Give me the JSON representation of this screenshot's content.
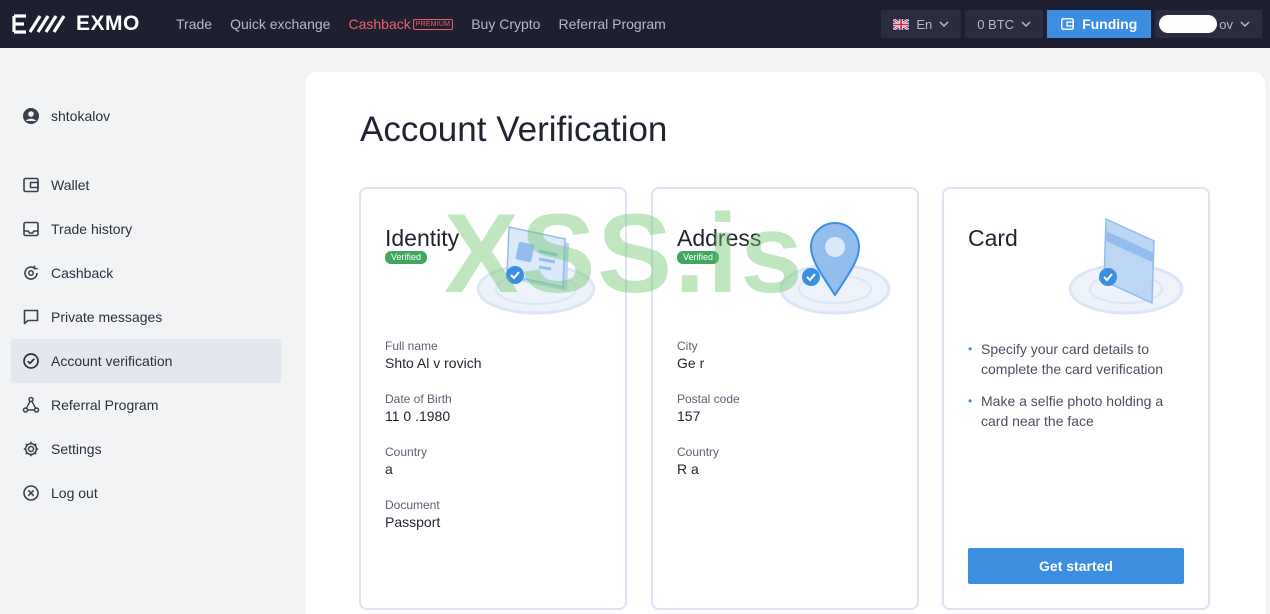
{
  "header": {
    "logo_text": "EXMO",
    "nav": [
      {
        "label": "Trade"
      },
      {
        "label": "Quick exchange"
      },
      {
        "label": "Cashback",
        "badge": "PREMIUM"
      },
      {
        "label": "Buy Crypto"
      },
      {
        "label": "Referral Program"
      }
    ],
    "language": "En",
    "balance": "0 BTC",
    "funding_label": "Funding",
    "user_suffix": "ov"
  },
  "sidebar": {
    "username": "shtokalov",
    "items": [
      {
        "label": "Wallet",
        "icon": "wallet-icon"
      },
      {
        "label": "Trade history",
        "icon": "inbox-icon"
      },
      {
        "label": "Cashback",
        "icon": "cashback-icon"
      },
      {
        "label": "Private messages",
        "icon": "message-icon"
      },
      {
        "label": "Account verification",
        "icon": "check-circle-icon",
        "active": true
      },
      {
        "label": "Referral Program",
        "icon": "share-icon"
      },
      {
        "label": "Settings",
        "icon": "gear-icon"
      },
      {
        "label": "Log out",
        "icon": "logout-icon"
      }
    ]
  },
  "main": {
    "title": "Account Verification",
    "watermark": "XSS.is",
    "cards": {
      "identity": {
        "title": "Identity",
        "badge": "Verified",
        "fields": [
          {
            "label": "Full name",
            "value": "Shto      Al     v        rovich"
          },
          {
            "label": "Date of Birth",
            "value": "11 0  .1980"
          },
          {
            "label": "Country",
            "value": "      a"
          },
          {
            "label": "Document",
            "value": "Passport"
          }
        ]
      },
      "address": {
        "title": "Address",
        "badge": "Verified",
        "fields": [
          {
            "label": "City",
            "value": "Ge        r"
          },
          {
            "label": "Postal code",
            "value": "157"
          },
          {
            "label": "Country",
            "value": "R    a"
          }
        ]
      },
      "card": {
        "title": "Card",
        "bullets": [
          "Specify your card details to complete the card verification",
          "Make a selfie photo holding a card near the face"
        ],
        "cta": "Get started"
      }
    }
  },
  "colors": {
    "header_bg": "#1e2031",
    "accent": "#3c8ee0",
    "cashback": "#ef5f67",
    "verified": "#3fa75f"
  }
}
